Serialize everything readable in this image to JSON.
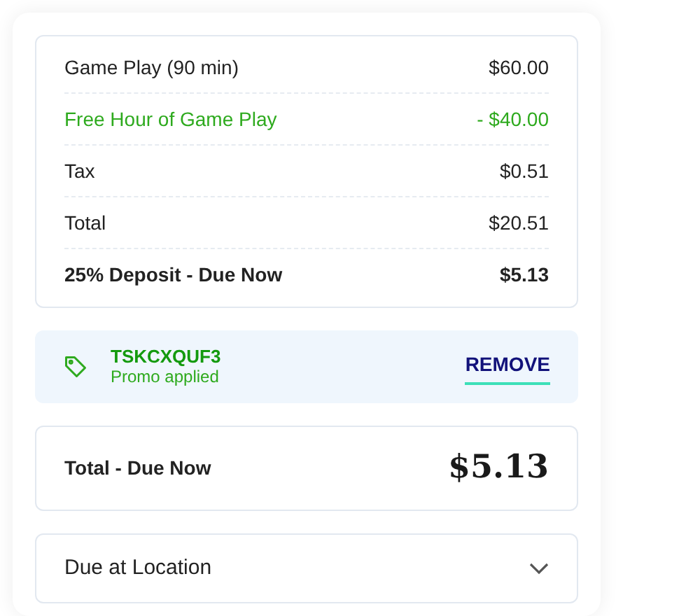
{
  "summary": {
    "rows": [
      {
        "label": "Game Play (90 min)",
        "amount": "$60.00",
        "kind": "normal"
      },
      {
        "label": "Free Hour of Game Play",
        "amount": "- $40.00",
        "kind": "discount"
      },
      {
        "label": "Tax",
        "amount": "$0.51",
        "kind": "normal"
      },
      {
        "label": "Total",
        "amount": "$20.51",
        "kind": "normal"
      },
      {
        "label": "25% Deposit - Due Now",
        "amount": "$5.13",
        "kind": "emphasis"
      }
    ]
  },
  "promo": {
    "code": "TSKCXQUF3",
    "status": "Promo applied",
    "action": "REMOVE"
  },
  "total_due": {
    "label": "Total - Due Now",
    "amount": "$5.13"
  },
  "due_at_location": {
    "label": "Due at Location",
    "expanded": false
  }
}
